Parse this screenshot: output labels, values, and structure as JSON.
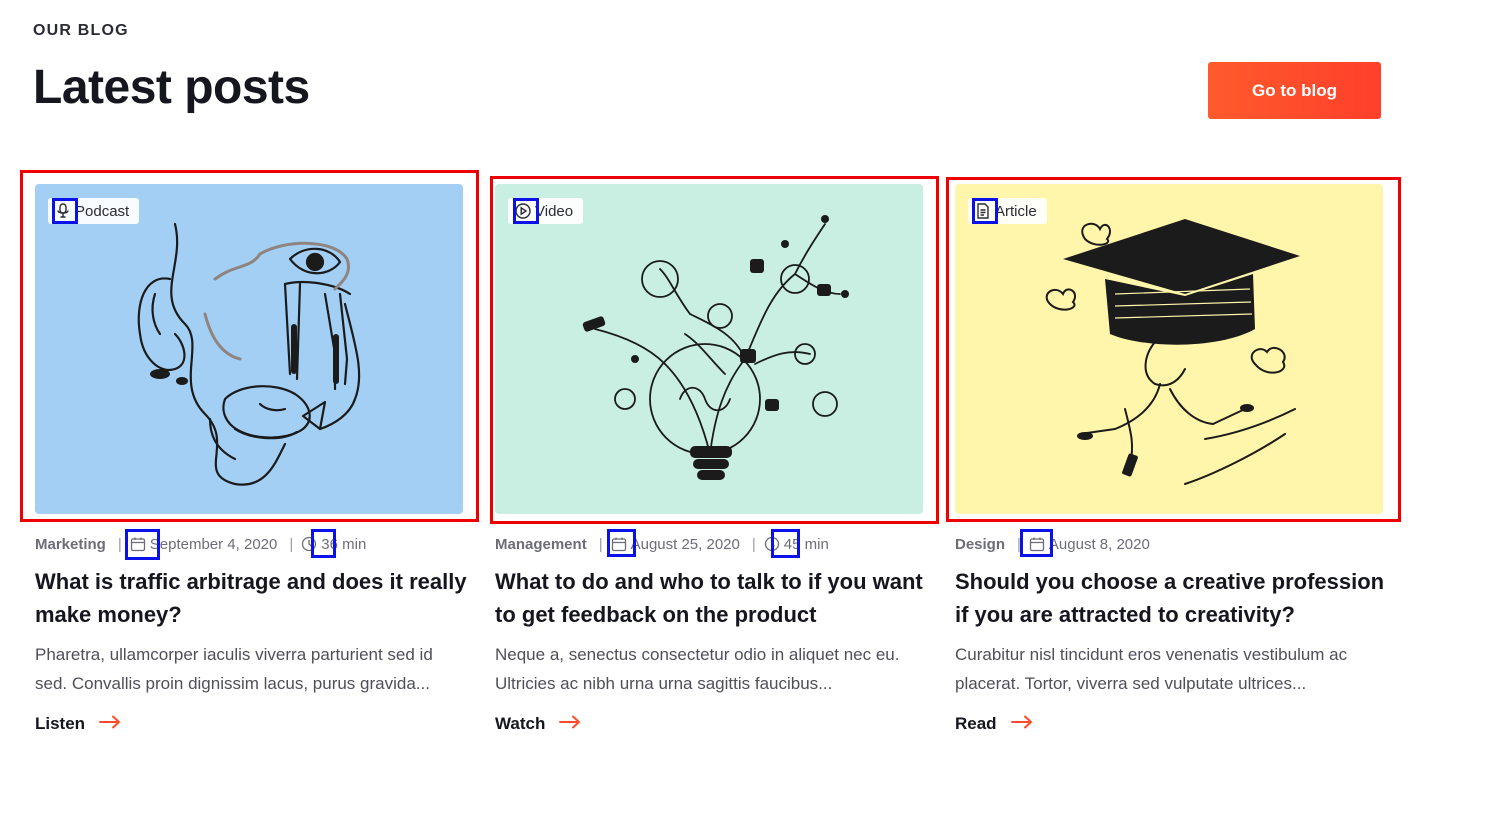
{
  "header": {
    "eyebrow": "OUR BLOG",
    "title": "Latest posts",
    "cta_label": "Go to blog"
  },
  "colors": {
    "accent": "#ff4b2b",
    "highlight_red": "#ee0000",
    "highlight_blue": "#0a12e8",
    "card_bg_1": "#a3cff5",
    "card_bg_2": "#c8efe1",
    "card_bg_3": "#fff5ab"
  },
  "posts": [
    {
      "type_label": "Podcast",
      "type_icon": "microphone-icon",
      "category": "Marketing",
      "date": "September 4, 2020",
      "duration": "36 min",
      "title": "What is traffic arbitrage and does it really make money?",
      "excerpt": "Pharetra, ullamcorper iaculis viverra parturient sed id sed. Convallis proin dignissim lacus, purus gravida...",
      "action": "Listen"
    },
    {
      "type_label": "Video",
      "type_icon": "play-circle-icon",
      "category": "Management",
      "date": "August 25, 2020",
      "duration": "45 min",
      "title": "What to do and who to talk to if you want to get feedback on the product",
      "excerpt": "Neque a, senectus consectetur odio in aliquet nec eu. Ultricies ac nibh urna urna sagittis faucibus...",
      "action": "Watch"
    },
    {
      "type_label": "Article",
      "type_icon": "document-icon",
      "category": "Design",
      "date": "August 8, 2020",
      "title": "Should you choose a creative profession if you are attracted to creativity?",
      "excerpt": "Curabitur nisl tincidunt eros venenatis vestibulum ac placerat. Tortor, viverra sed vulputate ultrices...",
      "action": "Read"
    }
  ]
}
